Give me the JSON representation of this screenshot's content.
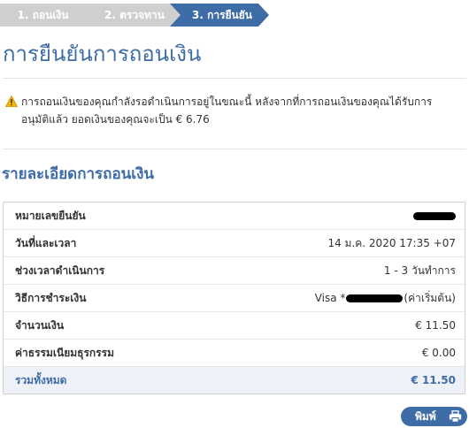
{
  "stepper": {
    "steps": [
      {
        "label": "1. ถอนเงิน",
        "state": "done"
      },
      {
        "label": "2. ตรวจทาน",
        "state": "done"
      },
      {
        "label": "3. การยืนยัน",
        "state": "active"
      }
    ]
  },
  "page": {
    "title": "การยืนยันการถอนเงิน"
  },
  "notice": {
    "icon": "warning-icon",
    "text": "การถอนเงินของคุณกำลังรอดำเนินการอยู่ในขณะนี้ หลังจากที่การถอนเงินของคุณได้รับการอนุมัติแล้ว ยอดเงินของคุณจะเป็น € 6.76"
  },
  "details": {
    "title": "รายละเอียดการถอนเงิน",
    "rows": [
      {
        "label": "หมายเลขยืนยัน",
        "value": ""
      },
      {
        "label": "วันที่และเวลา",
        "value": "14 ม.ค. 2020 17:35 +07"
      },
      {
        "label": "ช่วงเวลาดำเนินการ",
        "value": "1 - 3 วันทำการ"
      },
      {
        "label": "วิธีการชำระเงิน",
        "value_prefix": "Visa *",
        "value_suffix": "(ค่าเริ่มต้น)"
      },
      {
        "label": "จำนวนเงิน",
        "value": "€ 11.50"
      },
      {
        "label": "ค่าธรรมเนียมธุรกรรม",
        "value": "€ 0.00"
      },
      {
        "label": "รวมทั้งหมด",
        "value": "€ 11.50"
      }
    ]
  },
  "actions": {
    "print_label": "พิมพ์",
    "print_icon": "printer-icon"
  },
  "colors": {
    "accent": "#3d6ca7",
    "step_done": "#cfcfcf",
    "warning": "#f2b705"
  }
}
